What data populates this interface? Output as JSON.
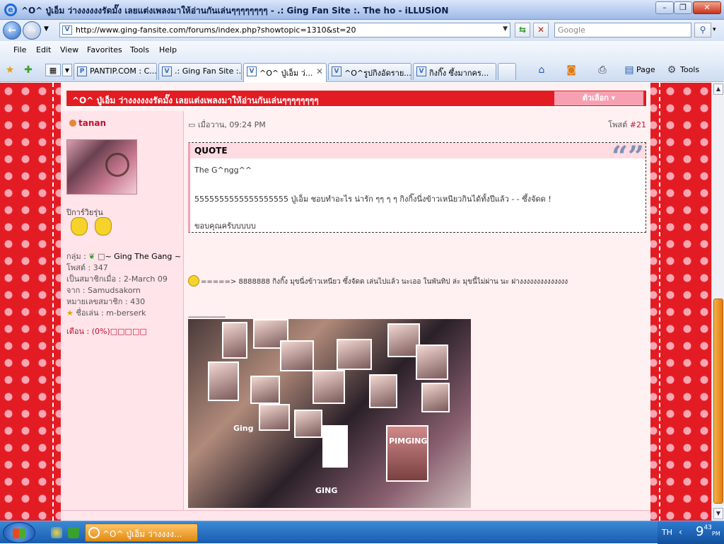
{
  "window": {
    "title": "^O^ ปู่เอ็ม ว่างงงงงงรัดมั๊ง เลยแต่งเพลงมาให้อ่านกันเล่นๆๆๆๆๆๆๆๆ - .: Ging Fan Site :. The ho - iLLUSiON",
    "minimize": "–",
    "restore": "❐",
    "close": "✕"
  },
  "address": {
    "url": "http://www.ging-fansite.com/forums/index.php?showtopic=1310&st=20",
    "search_placeholder": "Google"
  },
  "menu": [
    "File",
    "Edit",
    "View",
    "Favorites",
    "Tools",
    "Help"
  ],
  "tabs": [
    {
      "label": "PANTIP.COM : C...",
      "active": false
    },
    {
      "label": ".: Ging Fan Site :...",
      "active": false
    },
    {
      "label": "^O^ ปู่เอ็ม ว่...",
      "active": true
    },
    {
      "label": "^O^รูปกิงอัดราย...",
      "active": false
    },
    {
      "label": "กิงกิ๊ง ซึ้งมากคร...",
      "active": false
    }
  ],
  "toolbar": {
    "page": "Page",
    "tools": "Tools"
  },
  "forum": {
    "topic_title": "^O^ ปู่เอ็ม ว่างงงงงงรัดมั๊ง เลยแต่งเพลงมาให้อ่านกันเล่นๆๆๆๆๆๆๆๆ",
    "options_label": "ตัวเลือก ▾",
    "user": {
      "name": "tanan",
      "title": "ปิการ์วิยรุ่น",
      "group_label": "กลุ่ม :",
      "group_value": "~ Ging The Gang ~",
      "posts": "โพสต์ : 347",
      "joined": "เป็นสมาชิกเมื่อ : 2-March 09",
      "from": "จาก : Samudsakorn",
      "member_no": "หมายเลขสมาชิก : 430",
      "nickname": "ชื่อเล่น : m-berserk",
      "warn": "เตือน : (0%)□□□□□"
    },
    "post": {
      "date": "เมื่อวาน, 09:24 PM",
      "number_label": "โพสต์ ",
      "number": "#21",
      "quote_header": "QUOTE",
      "quote_lines": [
        "The G^ngg^^",
        "5555555555555555555 ปู่เอ็ม ชอบทำอะไร น่ารัก ๆๆ ๆ ๆ กิงกิ๊งนี่งข้าวเหนียวกินได้ทั้งปีแล้ว - - ซึ้งจัดด !",
        "ขอบคุณครับบบบบ"
      ],
      "reply_text": "=====>  8888888 กิงกิ๊ง มุขนี่งข้าวเหนียว ซึ้งจัดด เล่นไปแล้ว นะเออ ในพันทิป ล่ะ มุขนี้ไม่ผ่าน นะ ฝางงงงงงงงงงงงงง",
      "separator": "--------------------",
      "collage_labels": [
        "Ging",
        "PIMGING",
        "GING"
      ]
    }
  },
  "taskbar": {
    "task_label": "^O^ ปู่เอ็ม ว่างงงง...",
    "lang": "TH",
    "time_main": "9",
    "time_min": "43",
    "time_ampm": "PM"
  }
}
